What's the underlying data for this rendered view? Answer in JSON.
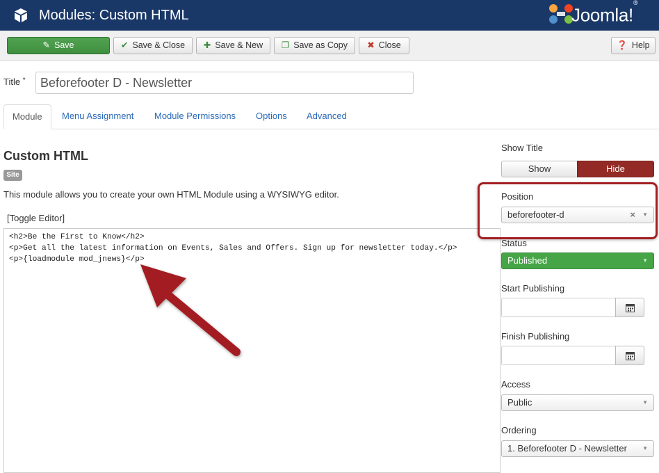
{
  "header": {
    "title": "Modules: Custom HTML",
    "logo_text": "Joomla!",
    "logo_mark": "®",
    "icon": "cube-icon"
  },
  "toolbar": {
    "save_label": "Save",
    "save_close_label": "Save & Close",
    "save_new_label": "Save & New",
    "save_copy_label": "Save as Copy",
    "close_label": "Close",
    "help_label": "Help"
  },
  "title_field": {
    "label": "Title",
    "required_mark": "*",
    "value": "Beforefooter D - Newsletter"
  },
  "tabs": [
    {
      "label": "Module",
      "active": true
    },
    {
      "label": "Menu Assignment"
    },
    {
      "label": "Module Permissions"
    },
    {
      "label": "Options"
    },
    {
      "label": "Advanced"
    }
  ],
  "module": {
    "heading": "Custom HTML",
    "badge": "Site",
    "description": "This module allows you to create your own HTML Module using a WYSIWYG editor.",
    "toggle_editor": "[Toggle Editor]",
    "editor_lines": [
      "<h2>Be the First to Know</h2>",
      "<p>Get all the latest information on Events, Sales and Offers. Sign up for newsletter today.</p>",
      "<p>{loadmodule mod_jnews}</p>"
    ]
  },
  "sidebar": {
    "show_title_label": "Show Title",
    "show_option": "Show",
    "hide_option": "Hide",
    "position_label": "Position",
    "position_value": "beforefooter-d",
    "status_label": "Status",
    "status_value": "Published",
    "start_publishing_label": "Start Publishing",
    "finish_publishing_label": "Finish Publishing",
    "access_label": "Access",
    "access_value": "Public",
    "ordering_label": "Ordering",
    "ordering_value": "1. Beforefooter D - Newsletter"
  },
  "colors": {
    "header_bg": "#1a3867",
    "save_green": "#46a546",
    "hide_red": "#942a25",
    "highlight_red": "#a31e22"
  }
}
